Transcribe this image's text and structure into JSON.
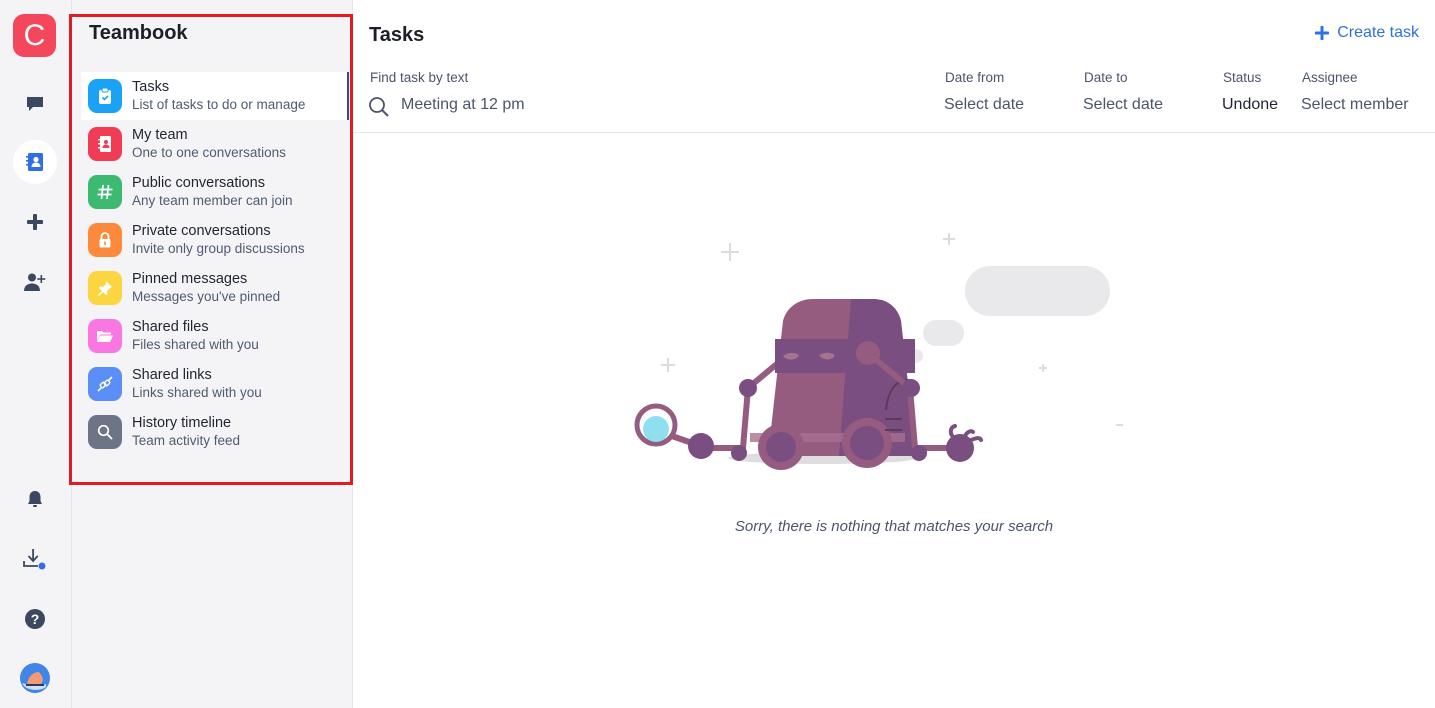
{
  "rail": {
    "logo_letter": "C",
    "logo_color": "#f5475c",
    "items": [
      {
        "name": "messages",
        "icon": "chat-bubble-icon"
      },
      {
        "name": "teambook",
        "icon": "contact-book-icon",
        "active": true
      },
      {
        "name": "add",
        "icon": "plus-icon"
      },
      {
        "name": "invite",
        "icon": "add-user-icon"
      }
    ],
    "bottom_items": [
      {
        "name": "notifications",
        "icon": "bell-icon"
      },
      {
        "name": "downloads",
        "icon": "download-icon",
        "badge": true
      },
      {
        "name": "help",
        "icon": "help-icon"
      },
      {
        "name": "profile",
        "icon": "avatar"
      }
    ]
  },
  "panel": {
    "title": "Teambook",
    "items": [
      {
        "label": "Tasks",
        "sub": "List of tasks to do or manage",
        "icon": "clipboard-check-icon",
        "color": "#1aa3f5",
        "active": true
      },
      {
        "label": "My team",
        "sub": "One to one conversations",
        "icon": "contact-book-icon",
        "color": "#f03c55"
      },
      {
        "label": "Public conversations",
        "sub": "Any team member can join",
        "icon": "hash-icon",
        "color": "#3dba72"
      },
      {
        "label": "Private conversations",
        "sub": "Invite only group discussions",
        "icon": "lock-icon",
        "color": "#fb8a3c"
      },
      {
        "label": "Pinned messages",
        "sub": "Messages you've pinned",
        "icon": "pin-icon",
        "color": "#fbd641"
      },
      {
        "label": "Shared files",
        "sub": "Files shared with you",
        "icon": "folder-icon",
        "color": "#f877e0"
      },
      {
        "label": "Shared links",
        "sub": "Links shared with you",
        "icon": "link-icon",
        "color": "#5b8ef6"
      },
      {
        "label": "History timeline",
        "sub": "Team activity feed",
        "icon": "search-icon",
        "color": "#6d7486"
      }
    ]
  },
  "main": {
    "title": "Tasks",
    "create_label": "Create task",
    "accent": "#2f6fe6",
    "filters": {
      "search_label": "Find task by text",
      "search_value": "Meeting at 12 pm",
      "date_from_label": "Date from",
      "date_from_value": "Select date",
      "date_to_label": "Date to",
      "date_to_value": "Select date",
      "status_label": "Status",
      "status_value": "Undone",
      "assignee_label": "Assignee",
      "assignee_value": "Select member"
    },
    "empty_message": "Sorry, there is nothing that matches your search"
  }
}
